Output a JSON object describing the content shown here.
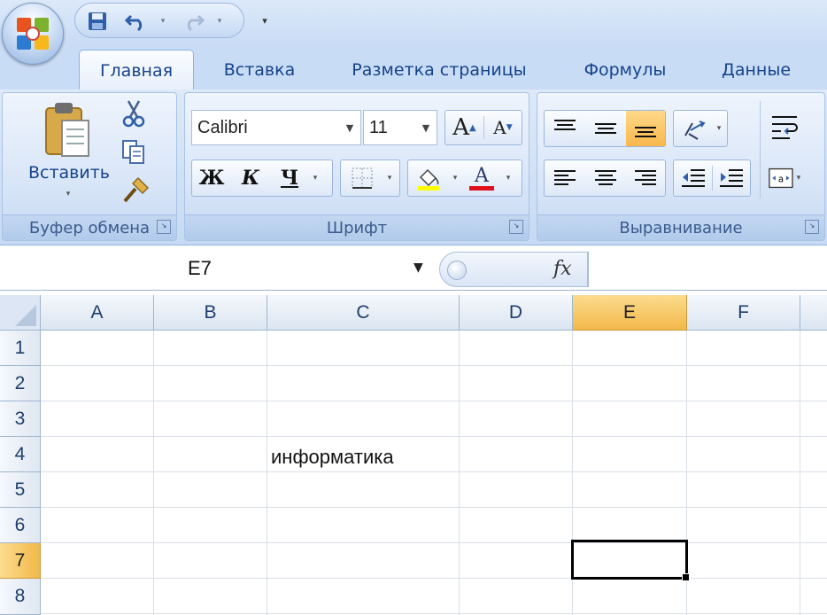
{
  "qat": {
    "save": "save-icon",
    "undo": "undo-icon",
    "redo": "redo-icon",
    "customize": "▾"
  },
  "tabs": [
    {
      "label": "Главная",
      "active": true
    },
    {
      "label": "Вставка",
      "active": false
    },
    {
      "label": "Разметка страницы",
      "active": false
    },
    {
      "label": "Формулы",
      "active": false
    },
    {
      "label": "Данные",
      "active": false
    }
  ],
  "clipboard": {
    "paste_label": "Вставить",
    "group_label": "Буфер обмена"
  },
  "font": {
    "name": "Calibri",
    "size": "11",
    "bold": "Ж",
    "italic": "К",
    "underline": "Ч",
    "grow": "A",
    "shrink": "A",
    "font_color_letter": "A",
    "group_label": "Шрифт",
    "fill_color": "#ffff00",
    "text_color": "#e0101a"
  },
  "alignment": {
    "group_label": "Выравнивание"
  },
  "formula_bar": {
    "name_box": "E7",
    "fx": "fx",
    "formula": ""
  },
  "sheet": {
    "columns": [
      "A",
      "B",
      "C",
      "D",
      "E",
      "F"
    ],
    "rows": [
      "1",
      "2",
      "3",
      "4",
      "5",
      "6",
      "7",
      "8"
    ],
    "selected_column": "E",
    "selected_row": "7",
    "cells": {
      "C4": "информатика"
    }
  },
  "colors": {
    "ribbon": "#c9dcf5",
    "selection_header": "#f8c660",
    "tab_text": "#15428b"
  }
}
